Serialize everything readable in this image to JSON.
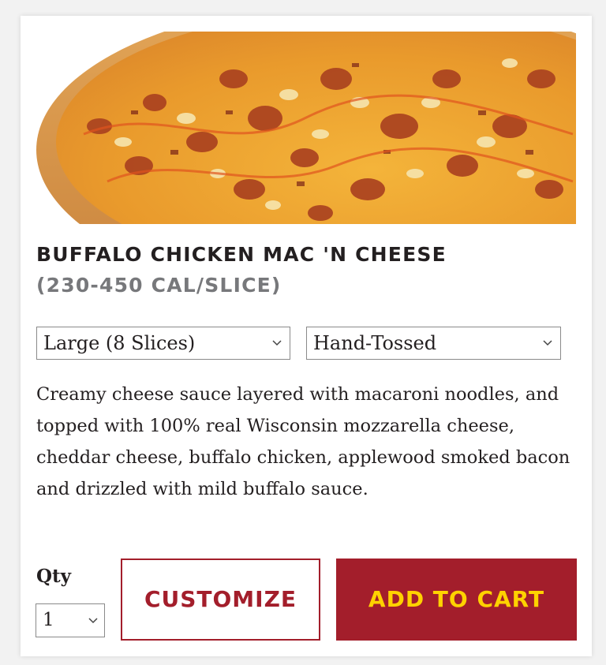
{
  "product": {
    "image_alt": "pizza-photo",
    "name": "BUFFALO CHICKEN MAC 'N CHEESE",
    "calories": "(230-450 CAL/SLICE)",
    "description": "Creamy cheese sauce layered with macaroni noodles, and topped with 100% real Wisconsin mozzarella cheese, cheddar cheese, buffalo chicken, applewood smoked bacon and drizzled with mild buffalo sauce."
  },
  "options": {
    "size_selected": "Large (8 Slices)",
    "crust_selected": "Hand-Tossed"
  },
  "quantity": {
    "label": "Qty",
    "selected": "1"
  },
  "actions": {
    "customize_label": "CUSTOMIZE",
    "add_to_cart_label": "ADD TO CART"
  },
  "colors": {
    "brand_red": "#a31e2b",
    "brand_yellow": "#ffd200",
    "text_dark": "#231f20",
    "text_gray": "#77787b"
  },
  "icons": {
    "dropdown": "chevron-down-icon"
  }
}
